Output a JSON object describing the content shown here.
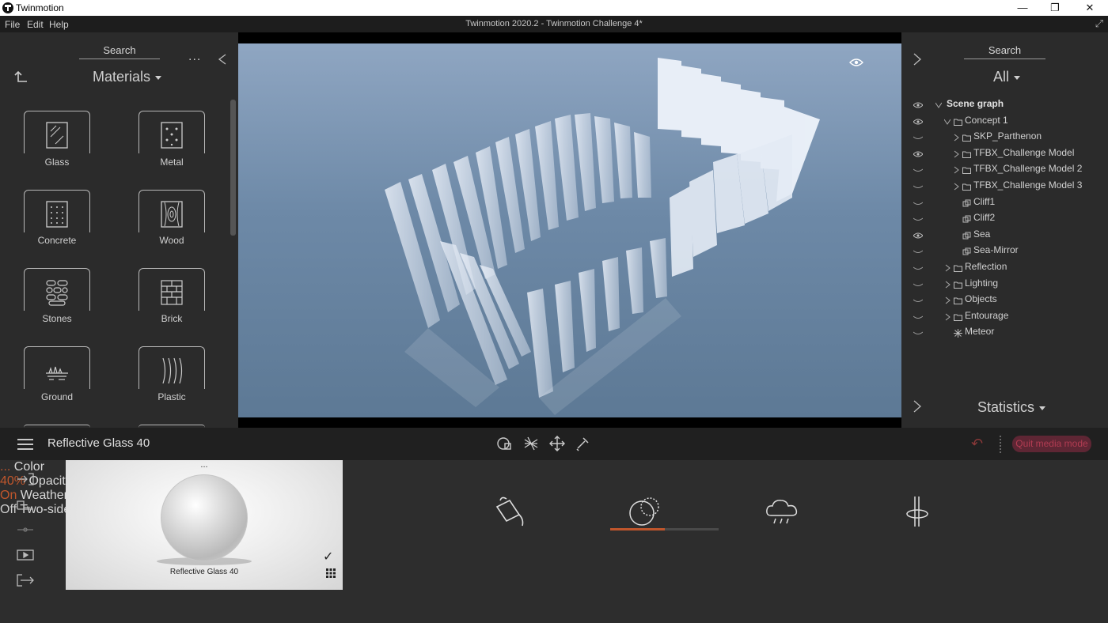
{
  "window": {
    "app_title": "Twinmotion",
    "document_title": "Twinmotion 2020.2 - Twinmotion Challenge 4*",
    "minimize": "—",
    "maximize": "❐",
    "close": "✕"
  },
  "menu": {
    "file": "File",
    "edit": "Edit",
    "help": "Help"
  },
  "library": {
    "search_label": "Search",
    "more": "...",
    "category": "Materials",
    "items": [
      {
        "label": "Glass",
        "icon": "glass-icon"
      },
      {
        "label": "Metal",
        "icon": "metal-icon"
      },
      {
        "label": "Concrete",
        "icon": "concrete-icon"
      },
      {
        "label": "Wood",
        "icon": "wood-icon"
      },
      {
        "label": "Stones",
        "icon": "stones-icon"
      },
      {
        "label": "Brick",
        "icon": "brick-icon"
      },
      {
        "label": "Ground",
        "icon": "ground-icon"
      },
      {
        "label": "Plastic",
        "icon": "plastic-icon"
      }
    ]
  },
  "scene_panel": {
    "search_label": "Search",
    "filter": "All",
    "statistics": "Statistics",
    "tree": [
      {
        "label": "Scene graph",
        "visible": true,
        "bold": true
      },
      {
        "label": "Concept 1",
        "visible": true
      },
      {
        "label": "SKP_Parthenon",
        "visible": false
      },
      {
        "label": "TFBX_Challenge Model",
        "visible": true
      },
      {
        "label": "TFBX_Challenge Model 2",
        "visible": false
      },
      {
        "label": "TFBX_Challenge Model 3",
        "visible": false
      },
      {
        "label": "Cliff1",
        "visible": false
      },
      {
        "label": "Cliff2",
        "visible": false
      },
      {
        "label": "Sea",
        "visible": true
      },
      {
        "label": "Sea-Mirror",
        "visible": false
      },
      {
        "label": "Reflection",
        "visible": false
      },
      {
        "label": "Lighting",
        "visible": false
      },
      {
        "label": "Objects",
        "visible": false
      },
      {
        "label": "Entourage",
        "visible": false
      },
      {
        "label": "Meteor",
        "visible": false
      }
    ]
  },
  "toolbar": {
    "material_name": "Reflective Glass 40",
    "quit_media_mode": "Quit media mode",
    "undo": "↶"
  },
  "material_preview": {
    "title": "Reflective Glass 40",
    "dots": "...",
    "check": "✓"
  },
  "properties": {
    "color": {
      "label": "Color",
      "value": "..."
    },
    "opacity": {
      "label": "Opacity",
      "value": "40%",
      "fraction": 0.5
    },
    "weather": {
      "label": "Weather",
      "value": "On"
    },
    "two_sided": {
      "label": "Two-sided",
      "value": "Off"
    }
  },
  "colors": {
    "accent_orange": "#c0562c",
    "quit_bg": "#5e2634",
    "quit_text": "#b23c52"
  }
}
